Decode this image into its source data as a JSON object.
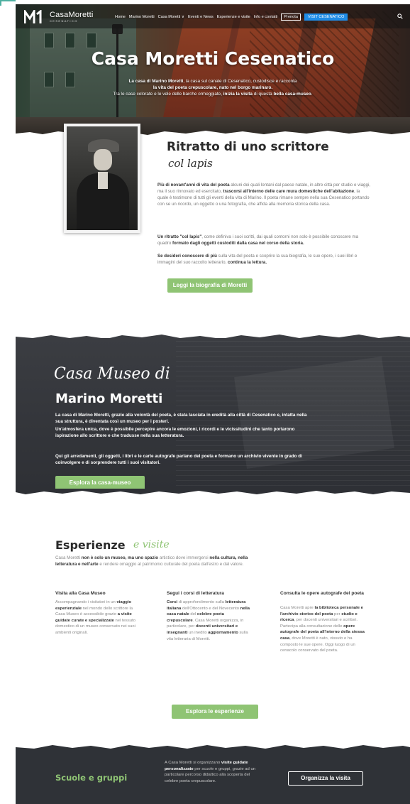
{
  "site": {
    "logo_name": "CasaMoretti",
    "logo_sub": "CESENATICO"
  },
  "nav": {
    "items": [
      {
        "label": "Home"
      },
      {
        "label": "Marino Moretti"
      },
      {
        "label": "Casa Moretti ∨"
      },
      {
        "label": "Eventi e News"
      },
      {
        "label": "Esperienze e visite"
      },
      {
        "label": "Info e contatti"
      }
    ],
    "prenota_label": "Prenota",
    "visit_label": "VISIT CESENATICO"
  },
  "hero": {
    "title": "Casa Moretti Cesenatico",
    "line1_a": "La casa di ",
    "line1_b": "Marino Moretti",
    "line1_c": ", la casa sul canale di Cesenatico, custodisce e racconta",
    "line2_a": "la vita del poeta crepuscolare, nato nel borgo marinaro.",
    "line3_a": "Tra le case colorate e le vele delle barche ormeggiate, ",
    "line3_b": "inizia la visita",
    "line3_c": " di questa ",
    "line3_d": "bella casa-museo",
    "line3_e": "."
  },
  "portrait_section": {
    "title": "Ritratto di uno scrittore",
    "script": "col lapis",
    "p1_a": "Più di novant'anni di vita del poeta",
    "p1_b": " alcuni dei quali lontani dal paese natale, in altre città per studio e viaggi, ma il suo rinnovato ed esercitato, ",
    "p1_c": "trascorsi all'interno delle care mura domestiche dell'abitazione",
    "p1_d": ", la quale è testimone di tutti gli eventi della vita di Marino. Il poeta rimane sempre nella sua Cesenatico portando con se un ricordo, un oggetto o una fotografia, che affida alla memoria storica della casa.",
    "p2_a": "Un ritratto \"col lapis\"",
    "p2_b": ", come definiva i suoi scritti, dai quali contorni non solo è possibile conoscere ma quadro ",
    "p2_c": "formato dagli oggetti custoditi dalla casa nel corso della storia.",
    "p3_a": "Se desideri conoscere di più",
    "p3_b": " sulla vita del poeta e scoprire la sua biografia, le sue opere, i suoi libri e immagini del suo raccolto letterario, ",
    "p3_c": "continua la lettura.",
    "button": "Leggi la biografia di Moretti"
  },
  "museum_section": {
    "script": "Casa Museo di",
    "title": "Marino Moretti",
    "p1": "La casa di Marino Moretti, grazie alla volontà del poeta, è stata lasciata in eredità alla città di Cesenatico e, intatta nella sua struttura, è diventata così un museo per i posteri.",
    "p2": "Un'atmosfera unica, dove è possibile percepire ancora le emozioni, i ricordi e le vicissitudini che tanto portarono ispirazione allo scrittore e che tradusse nella sua letteratura.",
    "p3": "Qui gli arredamenti, gli oggetti, i libri e le carte autografe parlano del poeta e formano un archivio vivente in grado di coinvolgere e di sorprendere tutti i suoi visitatori.",
    "button": "Esplora la casa-museo"
  },
  "experiences": {
    "title": "Esperienze",
    "script": "e visite",
    "intro_a": "Casa Moretti ",
    "intro_b": "non è solo un museo, ma uno spazio",
    "intro_c": " artistico dove immergersi ",
    "intro_d": "nella cultura, nella letteratura e nell'arte",
    "intro_e": " e rendere omaggio al patrimonio culturale del poeta dall'estro e dal valore.",
    "columns": [
      {
        "title": "Visita alla Casa Museo",
        "t_a": "Accompagnando i visitatori in un ",
        "t_b": "viaggio esperienziale",
        "t_c": " nel mondo dello scrittore la Casa Museo è accessibile grazie ",
        "t_d": "a visite guidate curate e specializzate",
        "t_e": " nel tessuto domestico di un museo conservato nei suoi ambienti originali."
      },
      {
        "title": "Segui i corsi di letteratura",
        "t_a": "Corsi",
        "t_b": " di approfondimento sulla ",
        "t_c": "letteratura italiana",
        "t_d": " dell'Ottocento e del Novecento ",
        "t_e": "nella casa natale",
        "t_f": " del ",
        "t_g": "celebre poeta crepuscolare",
        "t_h": ". Casa Moretti organizza, in particolare, per ",
        "t_i": "docenti universitari e insegnanti",
        "t_j": " un inedito ",
        "t_k": "aggiornamento",
        "t_l": " sulla vita letteraria di Moretti."
      },
      {
        "title": "Consulta le opere autografe del poeta",
        "t_a": "Casa Moretti apre ",
        "t_b": "la biblioteca personale e l'archivio storico del poeta",
        "t_c": " per ",
        "t_d": "studio e ricerca",
        "t_e": ", per docenti universitari e scrittori. Partecipa alla consultazione delle ",
        "t_f": "opere autografe del poeta all'interno della stessa casa",
        "t_g": ", dove Moretti è nato, vissuto e ha composto le sue opere. Oggi luogo di un cenacolo conservato del poeta."
      }
    ],
    "button": "Esplora le esperienze"
  },
  "groups": {
    "title": "Scuole e gruppi",
    "t_a": "A Casa Moretti si organizzano ",
    "t_b": "visite guidate personalizzate",
    "t_c": " per scuole e gruppi, grazie ad un particolare percorso didattico alla scoperta del celebre poeta crepuscolare.",
    "button": "Organizza la visita"
  },
  "colors": {
    "accent_green": "#8fc474",
    "nav_blue": "#1f8ce6",
    "dark_band": "#2f3237"
  }
}
